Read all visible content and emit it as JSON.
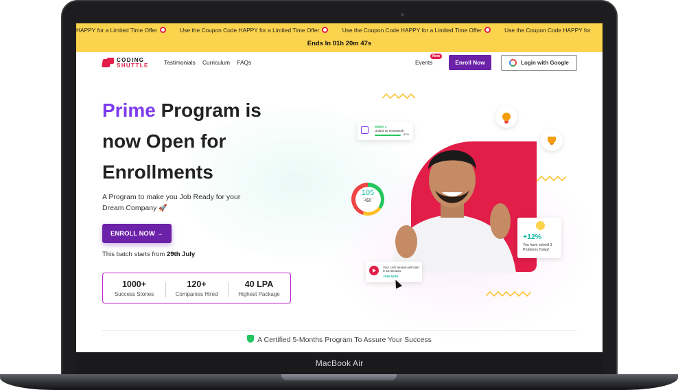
{
  "device": {
    "label": "MacBook Air"
  },
  "promo": {
    "ticker_text": "Use the Coupon Code HAPPY for a Limited Time Offer",
    "ticker_first": "HAPPY for a Limited Time Offer",
    "ticker_last": "Use the Coupon Code HAPPY for",
    "countdown": "Ends In 01h 20m 47s"
  },
  "nav": {
    "logo_line1": "CODING",
    "logo_line2": "SHUTTLE",
    "links": [
      "Testimonials",
      "Curriculum",
      "FAQs"
    ],
    "events": "Events",
    "new_badge": "New",
    "enroll": "Enroll Now",
    "google_login": "Login with Google"
  },
  "hero": {
    "headline_highlight": "Prime",
    "headline_rest1": " Program is",
    "headline_line2": "now Open for",
    "headline_line3": "Enrollments",
    "subtext": "A Program to make you Job Ready for your Dream Company",
    "cta": "ENROLL NOW →",
    "batch_prefix": "This batch starts from ",
    "batch_date": "29th July",
    "stats": [
      {
        "value": "1000+",
        "label": "Success Stories"
      },
      {
        "value": "120+",
        "label": "Companies Hired"
      },
      {
        "value": "40 LPA",
        "label": "Highest Package"
      }
    ],
    "certified": "A Certified 5-Months Program To Assure Your Success"
  },
  "illustration": {
    "week_title": "WEEK 1",
    "week_task": "Unlock Ur Homework",
    "week_progress": "87%",
    "ring_value": "105",
    "ring_total": "450",
    "solved_percent": "+12%",
    "solved_message": "You have solved 3 Problems Today!",
    "live_message": "Your LIVE session will start in 15 minutes",
    "live_cta": "JOIN NOW"
  },
  "colors": {
    "accent": "#6b21a8",
    "brand_red": "#e11d48",
    "promo_bg": "#fcd34d"
  }
}
